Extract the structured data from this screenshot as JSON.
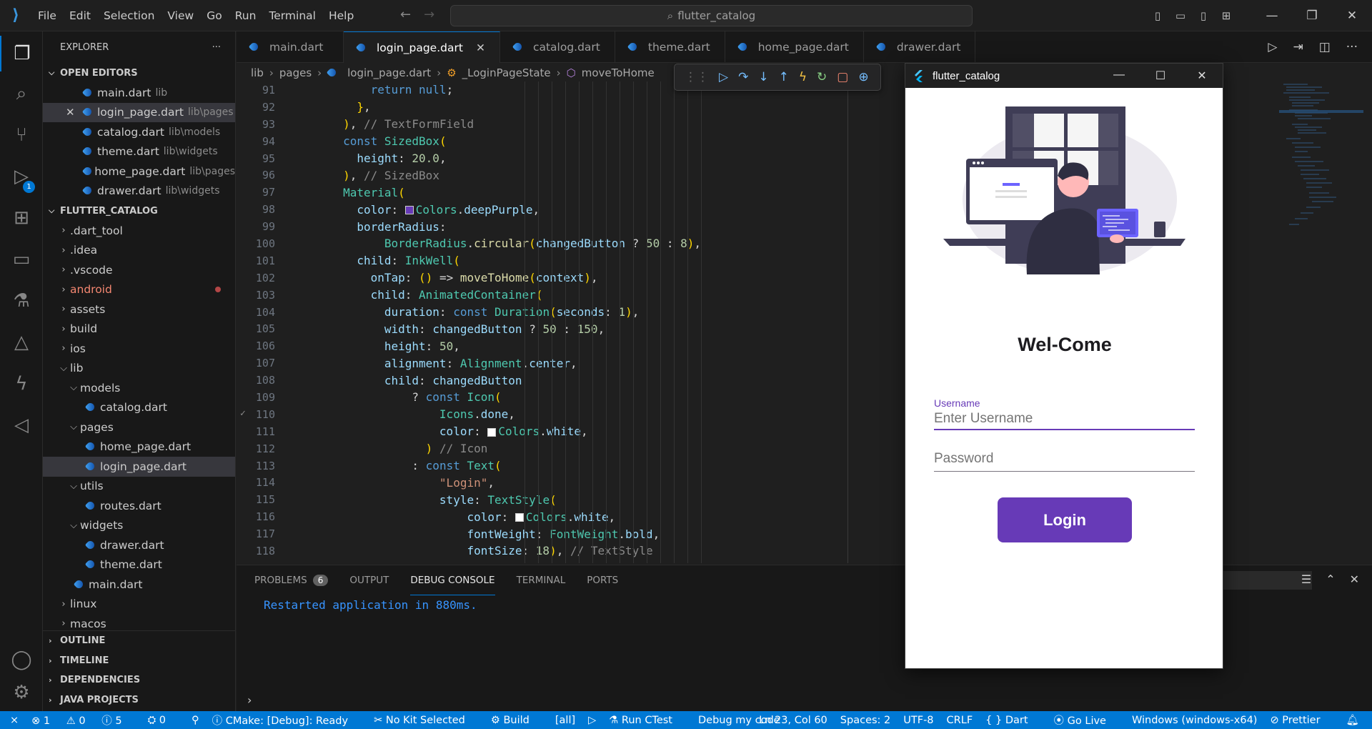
{
  "menu": [
    "File",
    "Edit",
    "Selection",
    "View",
    "Go",
    "Run",
    "Terminal",
    "Help"
  ],
  "search": {
    "text": "flutter_catalog"
  },
  "explorer": {
    "title": "EXPLORER",
    "open_editors_label": "OPEN EDITORS",
    "open_editors": [
      {
        "name": "main.dart",
        "dir": "lib"
      },
      {
        "name": "login_page.dart",
        "dir": "lib\\pages"
      },
      {
        "name": "catalog.dart",
        "dir": "lib\\models"
      },
      {
        "name": "theme.dart",
        "dir": "lib\\widgets"
      },
      {
        "name": "home_page.dart",
        "dir": "lib\\pages"
      },
      {
        "name": "drawer.dart",
        "dir": "lib\\widgets"
      }
    ],
    "project_label": "FLUTTER_CATALOG",
    "tree": [
      ".dart_tool",
      ".idea",
      ".vscode",
      "android",
      "assets",
      "build",
      "ios",
      "lib",
      "models",
      "catalog.dart",
      "pages",
      "home_page.dart",
      "login_page.dart",
      "utils",
      "routes.dart",
      "widgets",
      "drawer.dart",
      "theme.dart",
      "main.dart",
      "linux",
      "macos"
    ],
    "bottom_sections": [
      "OUTLINE",
      "TIMELINE",
      "DEPENDENCIES",
      "JAVA PROJECTS"
    ]
  },
  "tabs": [
    "main.dart",
    "login_page.dart",
    "catalog.dart",
    "theme.dart",
    "home_page.dart",
    "drawer.dart"
  ],
  "breadcrumb": [
    "lib",
    "pages",
    "login_page.dart",
    "_LoginPageState",
    "moveToHome"
  ],
  "code_lines": [
    {
      "n": "91",
      "t": "            return null;"
    },
    {
      "n": "92",
      "t": "          },"
    },
    {
      "n": "93",
      "t": "        ), // TextFormField"
    },
    {
      "n": "94",
      "t": "        const SizedBox("
    },
    {
      "n": "95",
      "t": "          height: 20.0,"
    },
    {
      "n": "96",
      "t": "        ), // SizedBox"
    },
    {
      "n": "97",
      "t": "        Material("
    },
    {
      "n": "98",
      "t": "          color: Colors.deepPurple,"
    },
    {
      "n": "99",
      "t": "          borderRadius:"
    },
    {
      "n": "100",
      "t": "              BorderRadius.circular(changedButton ? 50 : 8),"
    },
    {
      "n": "101",
      "t": "          child: InkWell("
    },
    {
      "n": "102",
      "t": "            onTap: () => moveToHome(context),"
    },
    {
      "n": "103",
      "t": "            child: AnimatedContainer("
    },
    {
      "n": "104",
      "t": "              duration: const Duration(seconds: 1),"
    },
    {
      "n": "105",
      "t": "              width: changedButton ? 50 : 150,"
    },
    {
      "n": "106",
      "t": "              height: 50,"
    },
    {
      "n": "107",
      "t": "              alignment: Alignment.center,"
    },
    {
      "n": "108",
      "t": "              child: changedButton"
    },
    {
      "n": "109",
      "t": "                  ? const Icon("
    },
    {
      "n": "110",
      "t": "                      Icons.done,"
    },
    {
      "n": "111",
      "t": "                      color: Colors.white,"
    },
    {
      "n": "112",
      "t": "                    ) // Icon"
    },
    {
      "n": "113",
      "t": "                  : const Text("
    },
    {
      "n": "114",
      "t": "                      \"Login\","
    },
    {
      "n": "115",
      "t": "                      style: TextStyle("
    },
    {
      "n": "116",
      "t": "                          color: Colors.white,"
    },
    {
      "n": "117",
      "t": "                          fontWeight: FontWeight.bold,"
    },
    {
      "n": "118",
      "t": "                          fontSize: 18), // TextStyle"
    }
  ],
  "panel": {
    "tabs": [
      "PROBLEMS",
      "OUTPUT",
      "DEBUG CONSOLE",
      "TERMINAL",
      "PORTS"
    ],
    "problems_count": "6",
    "console_output": "Restarted application in 880ms."
  },
  "status": {
    "errors": "1",
    "warnings": "0",
    "info": "5",
    "ports": "0",
    "cmake": "CMake: [Debug]: Ready",
    "kit": "No Kit Selected",
    "build": "Build",
    "all": "[all]",
    "ctest": "Run CTest",
    "debug": "Debug my code",
    "position": "Ln 23, Col 60",
    "spaces": "Spaces: 2",
    "encoding": "UTF-8",
    "eol": "CRLF",
    "lang": "Dart",
    "golive": "Go Live",
    "platform": "Windows (windows-x64)",
    "prettier": "Prettier"
  },
  "app": {
    "window_title": "flutter_catalog",
    "welcome": "Wel-Come",
    "username_label": "Username",
    "username_placeholder": "Enter Username",
    "password_placeholder": "Password",
    "login_label": "Login",
    "accent": "#673ab7"
  }
}
